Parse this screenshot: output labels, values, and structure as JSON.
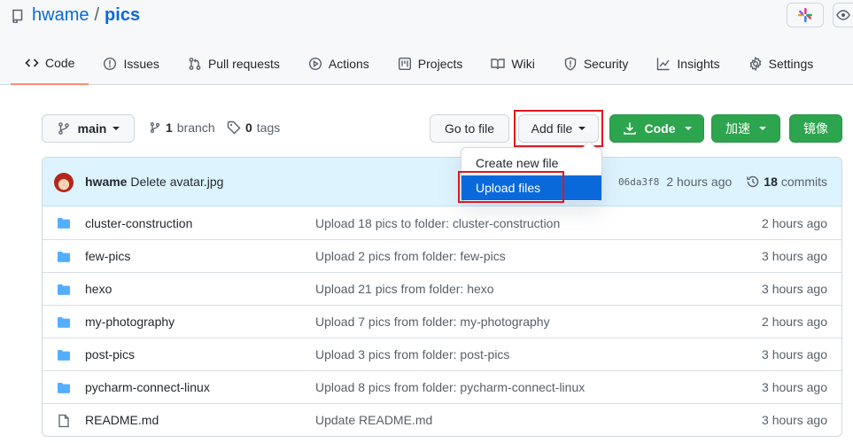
{
  "repo": {
    "owner": "hwame",
    "separator": "/",
    "name": "pics"
  },
  "tabs": [
    {
      "label": "Code",
      "icon": "code-icon"
    },
    {
      "label": "Issues",
      "icon": "issue-icon"
    },
    {
      "label": "Pull requests",
      "icon": "pull-request-icon"
    },
    {
      "label": "Actions",
      "icon": "play-icon"
    },
    {
      "label": "Projects",
      "icon": "project-icon"
    },
    {
      "label": "Wiki",
      "icon": "book-icon"
    },
    {
      "label": "Security",
      "icon": "shield-icon"
    },
    {
      "label": "Insights",
      "icon": "graph-icon"
    },
    {
      "label": "Settings",
      "icon": "gear-icon"
    }
  ],
  "toolbar": {
    "branch_select": "main",
    "branch_count": "1",
    "branch_label": "branch",
    "tag_count": "0",
    "tag_label": "tags",
    "go_to_file": "Go to file",
    "add_file": "Add file",
    "code": "Code",
    "speed": "加速",
    "mirror": "镜像"
  },
  "dropdown": {
    "items": [
      "Create new file",
      "Upload files"
    ],
    "active_index": 1
  },
  "latest_commit": {
    "author": "hwame",
    "message": "Delete avatar.jpg",
    "sha": "06da3f8",
    "time": "2 hours ago",
    "commit_count": "18",
    "commit_label": "commits"
  },
  "files": [
    {
      "type": "folder",
      "name": "cluster-construction",
      "message": "Upload 18 pics to folder: cluster-construction",
      "age": "2 hours ago"
    },
    {
      "type": "folder",
      "name": "few-pics",
      "message": "Upload 2 pics from folder: few-pics",
      "age": "3 hours ago"
    },
    {
      "type": "folder",
      "name": "hexo",
      "message": "Upload 21 pics from folder: hexo",
      "age": "3 hours ago"
    },
    {
      "type": "folder",
      "name": "my-photography",
      "message": "Upload 7 pics from folder: my-photography",
      "age": "2 hours ago"
    },
    {
      "type": "folder",
      "name": "post-pics",
      "message": "Upload 3 pics from folder: post-pics",
      "age": "3 hours ago"
    },
    {
      "type": "folder",
      "name": "pycharm-connect-linux",
      "message": "Upload 8 pics from folder: pycharm-connect-linux",
      "age": "3 hours ago"
    },
    {
      "type": "file",
      "name": "README.md",
      "message": "Update README.md",
      "age": "3 hours ago"
    }
  ],
  "colors": {
    "link": "#0969da",
    "green": "#2da44e",
    "highlight": "#e0161e",
    "active_tab": "#fd8c73",
    "folder": "#54aeff"
  }
}
